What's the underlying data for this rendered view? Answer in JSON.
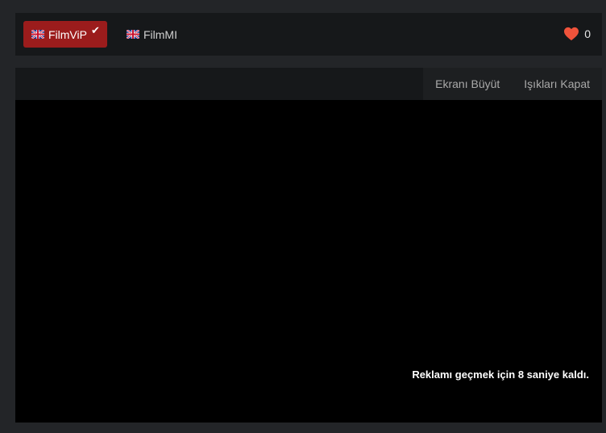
{
  "sources": [
    {
      "label": "FilmViP",
      "active": true,
      "flag": "uk-flag-icon",
      "check": "✔"
    },
    {
      "label": "FilmMI",
      "active": false,
      "flag": "uk-flag-icon"
    }
  ],
  "likes": {
    "icon": "heart-icon",
    "count": "0",
    "color": "#f0533b"
  },
  "toolbar": {
    "fullscreen_label": "Ekranı Büyüt",
    "lights_label": "Işıkları Kapat"
  },
  "player": {
    "ad_countdown": "Reklamı geçmek için 8 saniye kaldı."
  },
  "colors": {
    "active_source": "#9b1c1c",
    "background": "#232528",
    "panel": "#16181a"
  }
}
